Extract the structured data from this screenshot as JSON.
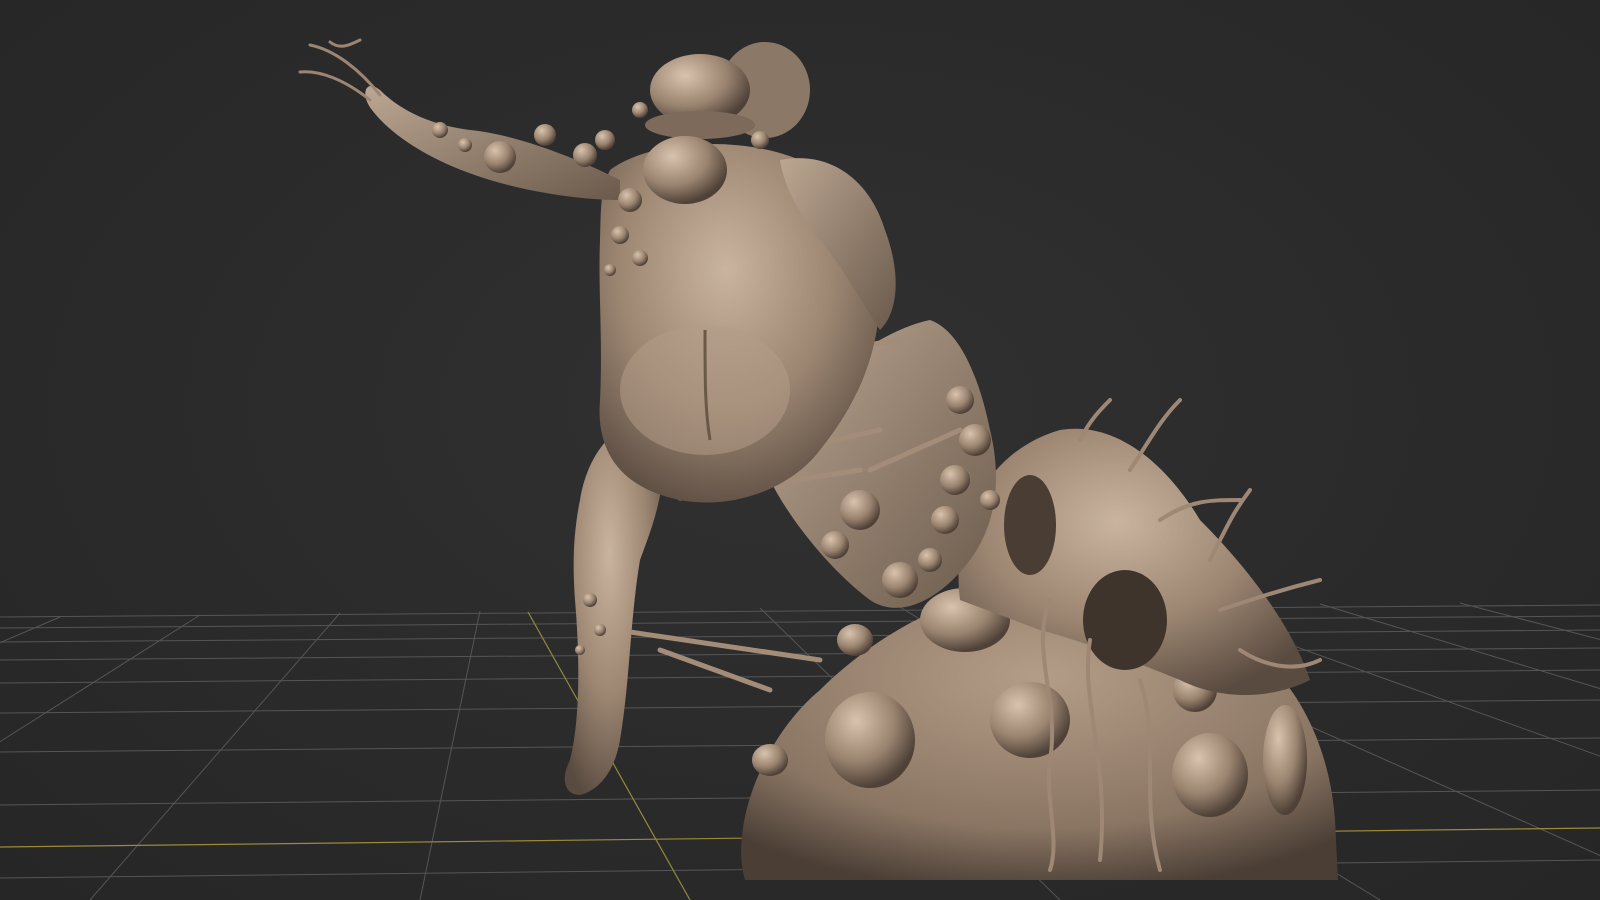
{
  "viewport": {
    "background_color": "#2b2b2b",
    "grid_color": "#5a5a5a",
    "axis_x_color": "#9a8a3a",
    "axis_z_color": "#8f8a3c",
    "grid_visible": true
  },
  "model": {
    "description_icon": "sculpt-mesh-figure",
    "material_color": "#a08b78",
    "material_highlight": "#c9b4a0",
    "material_shadow": "#4e4238"
  }
}
